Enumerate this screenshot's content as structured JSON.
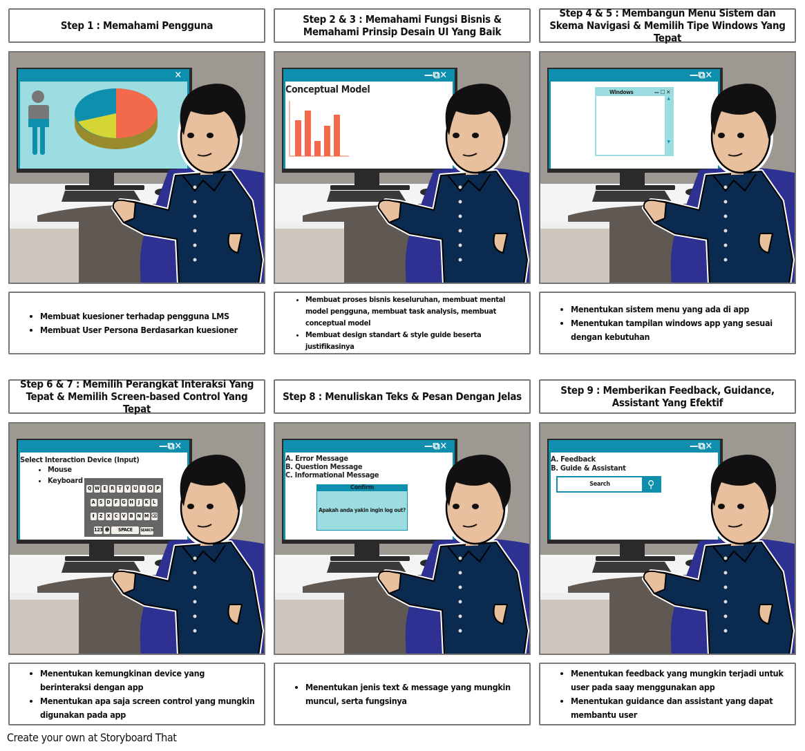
{
  "panels": [
    {
      "title": "Step 1 : Memahami Pengguna",
      "bullets": [
        "Membuat kuesioner terhadap pengguna LMS",
        "Membuat User Persona Berdasarkan kuesioner"
      ],
      "screen": {
        "controls": "✕"
      }
    },
    {
      "title": "Step 2 & 3 : Memahami Fungsi Bisnis & Memahami Prinsip Desain UI Yang Baik",
      "bullets": [
        "Membuat proses bisnis keseluruhan, membuat mental model pengguna, membuat task analysis, membuat conceptual model",
        "Membuat design standart & style guide beserta justifikasinya"
      ],
      "screen": {
        "controls": "—⧉✕",
        "heading": "Conceptual Model"
      }
    },
    {
      "title": "Step 4 & 5 : Membangun Menu Sistem dan Skema Navigasi & Memilih Tipe Windows Yang Tepat",
      "bullets": [
        "Menentukan sistem menu yang ada di app",
        "Menentukan tampilan windows app yang sesuai dengan kebutuhan"
      ],
      "screen": {
        "controls": "—⧉✕",
        "window_title": "Windows"
      }
    },
    {
      "title": "Step 6 & 7 : Memilih Perangkat Interaksi Yang Tepat & Memilih Screen-based Control Yang Tepat",
      "bullets": [
        "Menentukan kemungkinan device yang berinteraksi dengan app",
        "Menentukan apa saja screen control yang mungkin digunakan pada app"
      ],
      "screen": {
        "controls": "—⧉✕",
        "heading": "Select Interaction Device (Input)",
        "items": [
          "Mouse",
          "Keyboard"
        ],
        "keyboard": {
          "rows": [
            [
              "Q",
              "W",
              "E",
              "R",
              "T",
              "Y",
              "U",
              "I",
              "O",
              "P"
            ],
            [
              "A",
              "S",
              "D",
              "F",
              "G",
              "H",
              "J",
              "K",
              "L"
            ],
            [
              "⬆",
              "Z",
              "X",
              "C",
              "V",
              "B",
              "N",
              "M",
              "⌫"
            ]
          ],
          "bottom": [
            "123",
            "☻",
            "SPACE",
            "SEARCH"
          ]
        }
      }
    },
    {
      "title": "Step 8 : Menuliskan Teks & Pesan Dengan Jelas",
      "bullets": [
        "Menentukan jenis text & message yang mungkin muncul, serta fungsinya"
      ],
      "screen": {
        "controls": "—⧉✕",
        "lines": [
          "A. Error Message",
          "B. Question Message",
          "C. Informational Message"
        ],
        "dialog_title": "Confirm",
        "dialog_text": "Apakah anda yakin ingin log out?"
      }
    },
    {
      "title": "Step 9 : Memberikan Feedback, Guidance, Assistant Yang Efektif",
      "bullets": [
        "Menentukan feedback yang mungkin terjadi untuk user pada saay menggunakan app",
        "Menentukan guidance dan assistant yang dapat membantu user"
      ],
      "screen": {
        "controls": "—⧉✕",
        "lines": [
          "A. Feedback",
          "B. Guide & Assistant"
        ],
        "search_label": "Search"
      }
    }
  ],
  "footer": "Create your own at Storyboard That",
  "colors": {
    "wall": "#9e9892",
    "window": "#0e8fae",
    "screen_bg": "#9bdde0",
    "bar": "#f26a4b",
    "shirt": "#0b2a4f",
    "chair": "#2e3192"
  }
}
